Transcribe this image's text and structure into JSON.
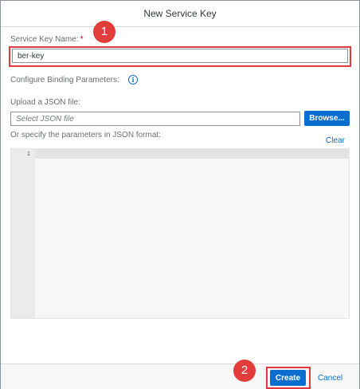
{
  "dialog": {
    "title": "New Service Key"
  },
  "form": {
    "service_key_name_label": "Service Key Name:",
    "required_marker": "*",
    "service_key_name_value": "ber-key",
    "configure_binding_label": "Configure Binding Parameters:",
    "upload_json_label": "Upload a JSON file:",
    "json_file_placeholder": "Select JSON file",
    "browse_button": "Browse...",
    "json_format_label": "Or specify the parameters in JSON format:",
    "clear_link": "Clear"
  },
  "editor": {
    "line_numbers": [
      "1"
    ]
  },
  "footer": {
    "create_button": "Create",
    "cancel_link": "Cancel"
  },
  "callouts": {
    "step1": "1",
    "step2": "2"
  },
  "icons": {
    "info": "info-icon"
  },
  "colors": {
    "accent": "#0a6ed1",
    "required": "#bb0000",
    "callout": "#e0393e"
  }
}
